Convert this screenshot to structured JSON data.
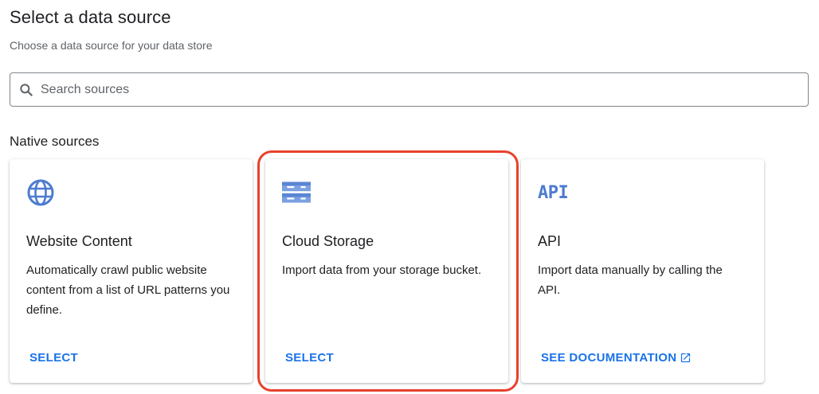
{
  "header": {
    "title": "Select a data source",
    "subtitle": "Choose a data source for your data store"
  },
  "search": {
    "placeholder": "Search sources",
    "value": ""
  },
  "native_sources": {
    "heading": "Native sources",
    "cards": [
      {
        "icon": "globe-icon",
        "title": "Website Content",
        "description": "Automatically crawl public website content from a list of URL patterns you define.",
        "action": "SELECT"
      },
      {
        "icon": "storage-icon",
        "title": "Cloud Storage",
        "description": "Import data from your storage bucket.",
        "action": "SELECT",
        "highlighted": true
      },
      {
        "icon": "api-icon",
        "icon_text": "API",
        "title": "API",
        "description": "Import data manually by calling the API.",
        "action": "SEE DOCUMENTATION",
        "action_icon": "open-in-new-icon"
      }
    ]
  },
  "colors": {
    "accent": "#1a73e8",
    "icon_blue": "#4c7bd0",
    "highlight": "#e8412c"
  }
}
